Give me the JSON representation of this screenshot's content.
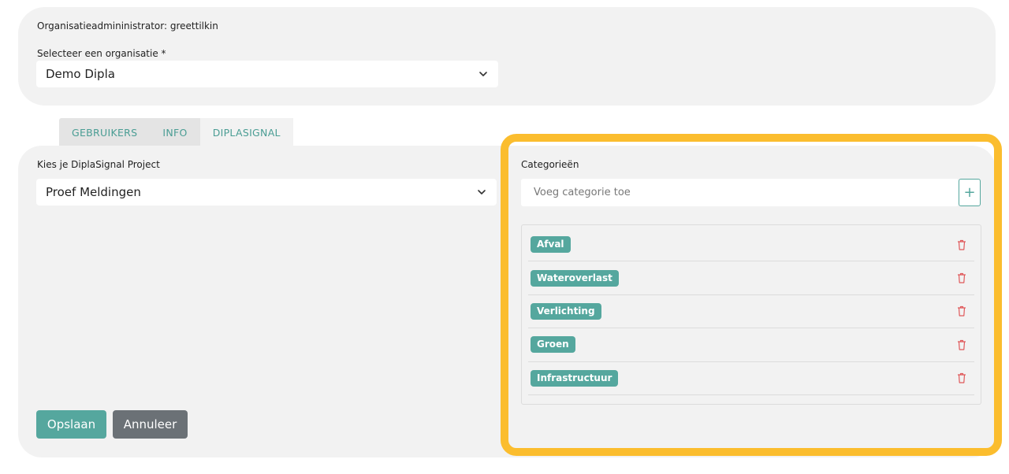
{
  "header": {
    "admin_line": "Organisatieadmininistrator: greettilkin",
    "org_label": "Selecteer een organisatie *",
    "org_selected": "Demo Dipla"
  },
  "tabs": [
    {
      "label": "GEBRUIKERS",
      "active": false
    },
    {
      "label": "INFO",
      "active": false
    },
    {
      "label": "DIPLASIGNAL",
      "active": true
    }
  ],
  "project": {
    "label": "Kies je DiplaSignal Project",
    "selected": "Proef Meldingen"
  },
  "categories": {
    "label": "Categorieën",
    "input_placeholder": "Voeg categorie toe",
    "add_symbol": "+",
    "items": [
      "Afval",
      "Wateroverlast",
      "Verlichting",
      "Groen",
      "Infrastructuur"
    ]
  },
  "actions": {
    "save_label": "Opslaan",
    "cancel_label": "Annuleer"
  },
  "colors": {
    "accent": "#55a79e",
    "cancel": "#6b7176",
    "delete": "#e0585a",
    "highlight": "#fbbd2e",
    "panel": "#f2f2f2"
  },
  "icons": {
    "select_chevron": "chevron-down-icon",
    "delete": "trash-icon",
    "add": "plus-icon"
  }
}
